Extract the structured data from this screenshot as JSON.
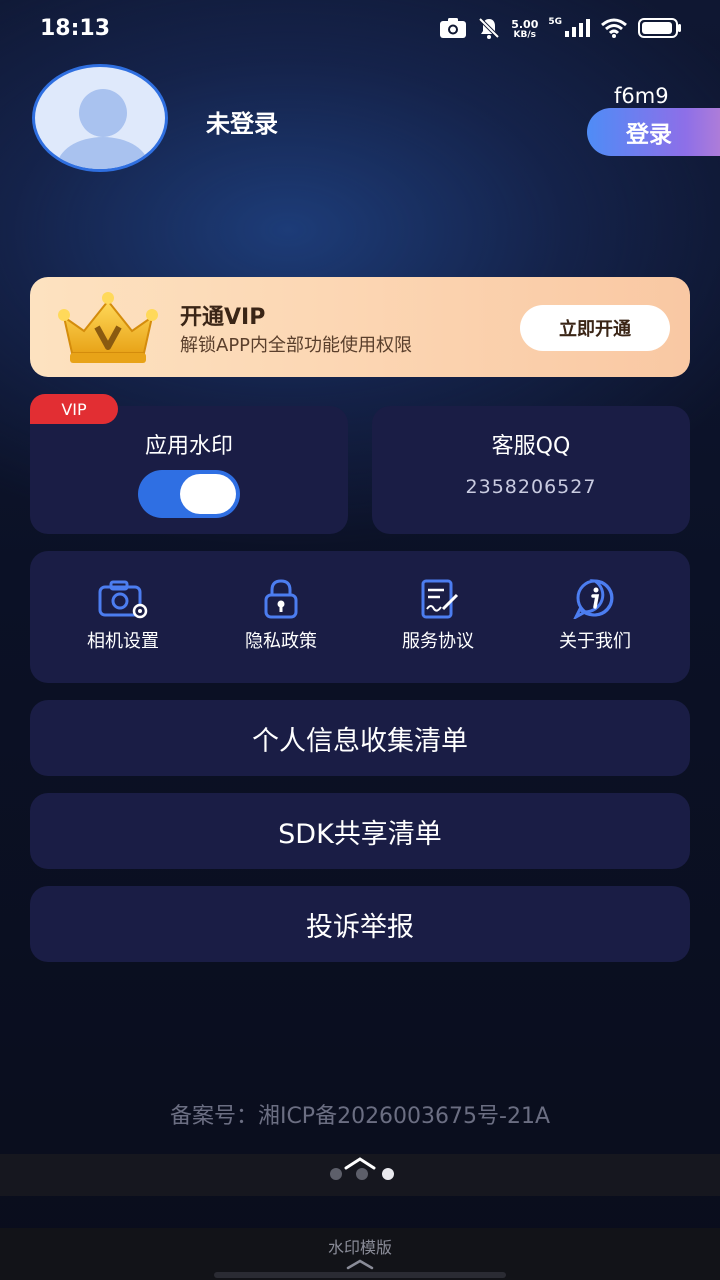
{
  "status_bar": {
    "time": "18:13",
    "net_speed": "5.00",
    "net_unit": "KB/s",
    "signal_type": "5G",
    "icons": [
      "camera-icon",
      "bell-muted-icon",
      "signal-icon",
      "wifi-icon",
      "battery-icon"
    ]
  },
  "profile": {
    "login_status": "未登录",
    "code": "f6m9",
    "login_button": "登录"
  },
  "vip_banner": {
    "title": "开通VIP",
    "subtitle": "解锁APP内全部功能使用权限",
    "button": "立即开通",
    "crown_letter": "V"
  },
  "watermark_card": {
    "tag": "VIP",
    "title": "应用水印",
    "toggle_on": true
  },
  "qq_card": {
    "title": "客服QQ",
    "number": "2358206527"
  },
  "quick_grid": [
    {
      "label": "相机设置",
      "icon": "camera-settings-icon"
    },
    {
      "label": "隐私政策",
      "icon": "lock-icon"
    },
    {
      "label": "服务协议",
      "icon": "document-sign-icon"
    },
    {
      "label": "关于我们",
      "icon": "info-icon"
    }
  ],
  "list_buttons": [
    {
      "label": "个人信息收集清单"
    },
    {
      "label": "SDK共享清单"
    },
    {
      "label": "投诉举报"
    }
  ],
  "footer": {
    "icp": "备案号：湘ICP备2026003675号-21A",
    "template_label": "水印模版"
  },
  "colors": {
    "accent_blue": "#2f6fe3",
    "card_bg": "#1a1d45",
    "vip_red": "#e22e33"
  }
}
